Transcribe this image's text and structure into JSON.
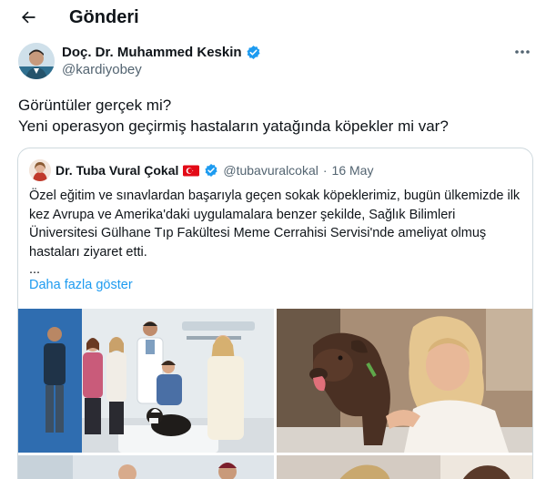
{
  "header": {
    "title": "Gönderi",
    "back_icon": "arrow-left-icon"
  },
  "author": {
    "name": "Doç. Dr. Muhammed Keskin",
    "handle": "@kardiyobey",
    "verified_icon": "verified-badge-icon",
    "verified_color": "#1d9bf0"
  },
  "post": {
    "line1": "Görüntüler gerçek mi?",
    "line2": "Yeni operasyon geçirmiş hastaların yatağında köpekler mi var?"
  },
  "quote": {
    "name": "Dr. Tuba Vural Çokal",
    "handle": "@tubavuralcokal",
    "separator": "·",
    "date": "16 May",
    "text": "Özel eğitim ve sınavlardan başarıyla geçen sokak köpeklerimiz, bugün ülkemizde ilk kez Avrupa ve Amerika'daki uygulamalara benzer şekilde, Sağlık Bilimleri Üniversitesi Gülhane Tıp Fakültesi Meme Cerrahisi Servisi'nde ameliyat olmuş hastaları ziyaret etti.",
    "ellipsis": "...",
    "show_more": "Daha fazla göster",
    "link_color": "#1d9bf0"
  },
  "colors": {
    "text": "#0f1419",
    "secondary": "#536471",
    "border": "#cfd9de"
  }
}
